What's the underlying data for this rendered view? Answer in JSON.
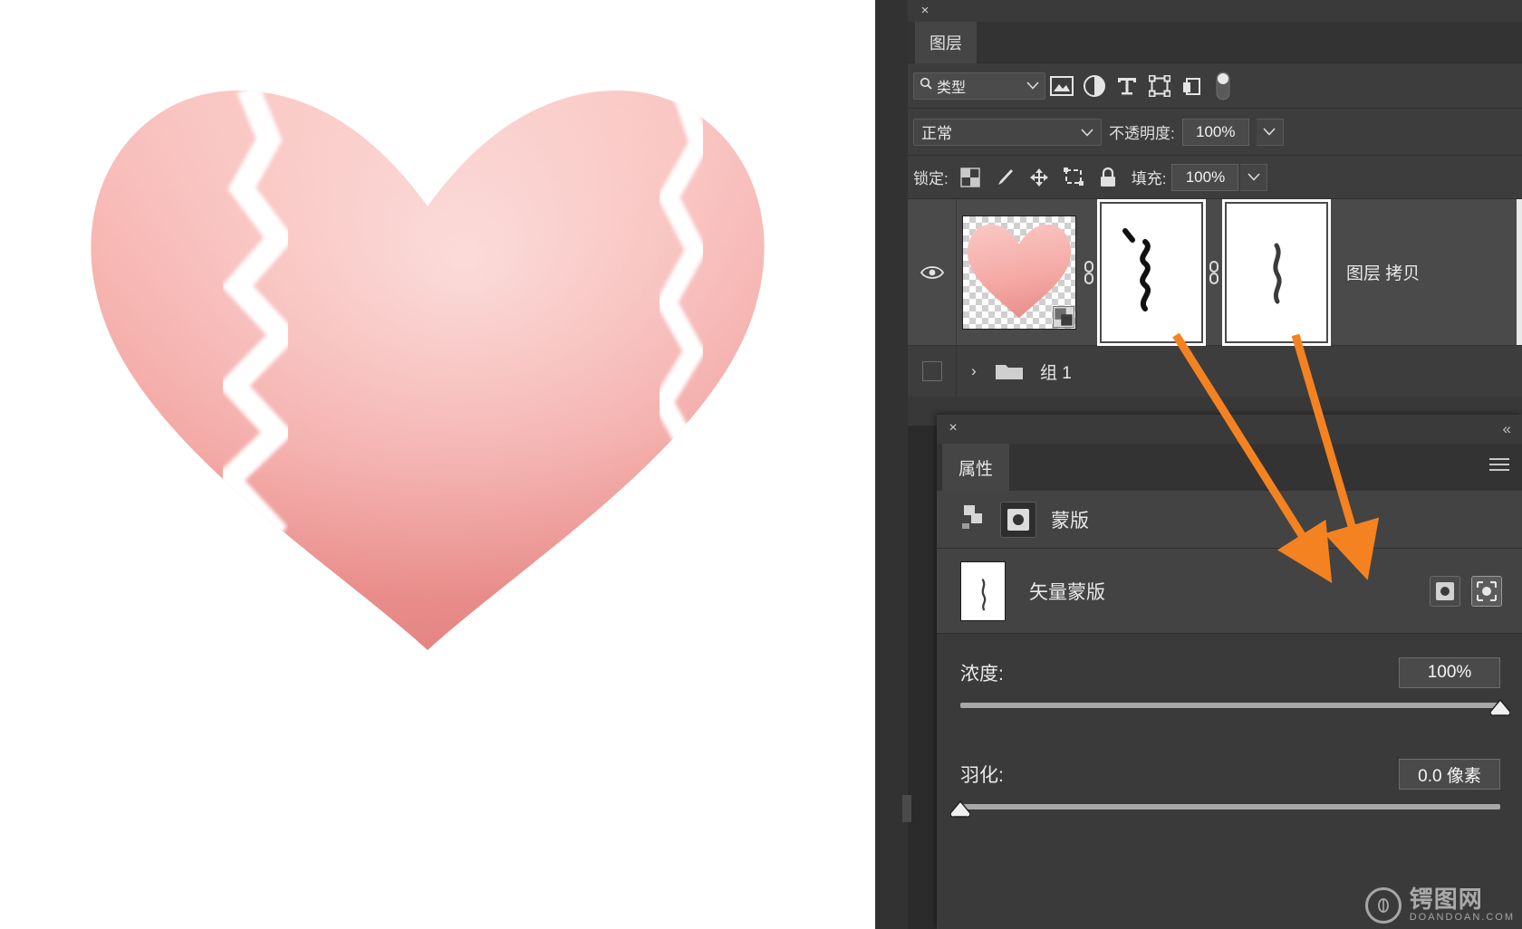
{
  "canvas": {
    "artwork_name": "broken-heart-illustration",
    "background": "#ffffff",
    "heart_gradient_top": "#f7b4b0",
    "heart_gradient_mid": "#f4a5a1",
    "heart_gradient_bottom": "#e98d8c"
  },
  "layers_panel": {
    "close_label": "×",
    "tab_label": "图层",
    "filter": {
      "search_icon": "search-icon",
      "value": "类型",
      "chevron": "⌄"
    },
    "filter_icons": [
      {
        "name": "pixel-layer-filter-icon",
        "label": "像素图层"
      },
      {
        "name": "adjustment-layer-filter-icon",
        "label": "调整图层"
      },
      {
        "name": "type-layer-filter-icon",
        "label": "文字图层"
      },
      {
        "name": "shape-layer-filter-icon",
        "label": "形状图层"
      },
      {
        "name": "smart-object-filter-icon",
        "label": "智能对象"
      }
    ],
    "filter_toggle": {
      "name": "filter-toggle-switch",
      "state": "off"
    },
    "blend_mode": {
      "label": "正常",
      "chevron": "⌄"
    },
    "opacity": {
      "label": "不透明度:",
      "value": "100%",
      "chevron": "⌄"
    },
    "lock": {
      "label": "锁定:",
      "icons": [
        {
          "name": "lock-transparent-pixels-icon"
        },
        {
          "name": "lock-image-pixels-icon"
        },
        {
          "name": "lock-position-icon"
        },
        {
          "name": "lock-artboard-nesting-icon"
        },
        {
          "name": "lock-all-icon"
        }
      ]
    },
    "fill": {
      "label": "填充:",
      "value": "100%",
      "chevron": "⌄"
    },
    "rows": [
      {
        "type": "layer",
        "visible": true,
        "eye_icon": "eye-icon",
        "thumbnail": "heart-thumbnail",
        "smart_object_badge": "smart-object-badge-icon",
        "link_icon_1": "link-icon",
        "mask_1": "layer-mask-thumbnail",
        "link_icon_2": "link-icon",
        "mask_2": "vector-mask-thumbnail",
        "name": "图层 拷贝",
        "selected": true
      },
      {
        "type": "group",
        "expand_arrow": "›",
        "folder_icon": "folder-icon",
        "name": "组 1",
        "checkbox": "group-visibility-checkbox"
      }
    ]
  },
  "properties_panel": {
    "close_label": "×",
    "collapse_label": "«",
    "tab_label": "属性",
    "menu_icon": "panel-menu-icon",
    "header": {
      "attach_icon": "attach-to-layer-icon",
      "mask_icon": "mask-thumbnail-icon",
      "title": "蒙版"
    },
    "vector_mask": {
      "thumbnail": "vector-mask-thumbnail",
      "label": "矢量蒙版",
      "buttons": [
        {
          "name": "load-selection-from-mask-button",
          "icon": "circle-mask-icon",
          "active": false
        },
        {
          "name": "apply-mask-button",
          "icon": "select-mask-icon",
          "active": true
        }
      ]
    },
    "density": {
      "label": "浓度:",
      "value": "100%",
      "percent": 100
    },
    "feather": {
      "label": "羽化:",
      "value": "0.0 像素",
      "percent": 0
    }
  },
  "annotations": {
    "arrow_color": "#f58220",
    "arrows": [
      {
        "name": "arrow-to-load-selection-button",
        "from": [
          1298,
          370
        ],
        "to": [
          1452,
          615
        ]
      },
      {
        "name": "arrow-to-apply-mask-button",
        "from": [
          1430,
          370
        ],
        "to": [
          1500,
          608
        ]
      }
    ]
  },
  "watermark": {
    "logo_icon": "doandoan-logo-icon",
    "cn_text": "锷图网",
    "en_text": "DOANDOAN.COM"
  }
}
